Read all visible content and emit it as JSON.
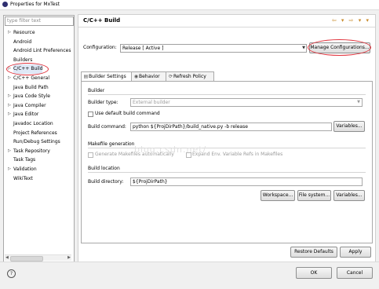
{
  "window": {
    "title": "Properties for MxTest"
  },
  "filter": {
    "placeholder": "type filter text"
  },
  "tree": [
    {
      "label": "Resource",
      "expandable": true
    },
    {
      "label": "Android",
      "expandable": false
    },
    {
      "label": "Android Lint Preferences",
      "expandable": false
    },
    {
      "label": "Builders",
      "expandable": false
    },
    {
      "label": "C/C++ Build",
      "expandable": true,
      "selected": true
    },
    {
      "label": "C/C++ General",
      "expandable": true
    },
    {
      "label": "Java Build Path",
      "expandable": false
    },
    {
      "label": "Java Code Style",
      "expandable": true
    },
    {
      "label": "Java Compiler",
      "expandable": true
    },
    {
      "label": "Java Editor",
      "expandable": true
    },
    {
      "label": "Javadoc Location",
      "expandable": false
    },
    {
      "label": "Project References",
      "expandable": false
    },
    {
      "label": "Run/Debug Settings",
      "expandable": false
    },
    {
      "label": "Task Repository",
      "expandable": true
    },
    {
      "label": "Task Tags",
      "expandable": false
    },
    {
      "label": "Validation",
      "expandable": true
    },
    {
      "label": "WikiText",
      "expandable": false
    }
  ],
  "page": {
    "title": "C/C++ Build",
    "nav_icons": "⇦ ▾ ⇨ ▾ ▾",
    "configuration_label": "Configuration:",
    "configuration_value": "Release  [ Active ]",
    "manage_button": "Manage Configurations..."
  },
  "tabs": [
    "Builder Settings",
    "Behavior",
    "Refresh Policy"
  ],
  "builder": {
    "group_label": "Builder",
    "builder_type_label": "Builder type:",
    "builder_type_value": "External builder",
    "use_default_label": "Use default build command",
    "build_command_label": "Build command:",
    "build_command_value": "python ${ProjDirPath}/build_native.py -b release",
    "variables_button": "Variables..."
  },
  "makefile": {
    "group_label": "Makefile generation",
    "generate_label": "Generate Makefiles automatically",
    "expand_label": "Expand Env. Variable Refs in Makefiles"
  },
  "location": {
    "group_label": "Build location",
    "dir_label": "Build directory:",
    "dir_value": "${ProjDirPath}",
    "workspace_button": "Workspace...",
    "filesystem_button": "File system...",
    "variables_button": "Variables..."
  },
  "footer": {
    "restore_button": "Restore Defaults",
    "apply_button": "Apply",
    "ok_button": "OK",
    "cancel_button": "Cancel",
    "help_icon": "?"
  },
  "watermark": "blog.csdn.net/"
}
